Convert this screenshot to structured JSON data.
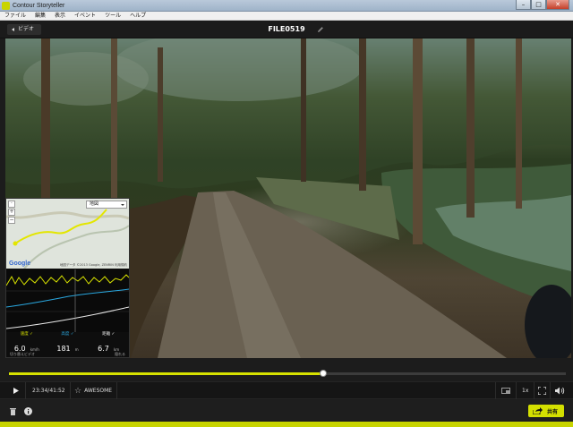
{
  "window": {
    "title": "Contour Storyteller",
    "min_icon": "minimize-icon",
    "max_icon": "maximize-icon",
    "close_icon": "close-icon"
  },
  "menu": {
    "items": [
      "ファイル",
      "編集",
      "表示",
      "イベント",
      "ツール",
      "ヘルプ"
    ]
  },
  "header": {
    "back_label": "ビデオ",
    "file_title": "FILE0519",
    "edit_icon": "pencil-icon"
  },
  "overlay": {
    "map_type": "地図",
    "map_credit": "地図データ ©2013 Google, ZENRIN  利用規約",
    "google_logo": "Google",
    "stats": [
      {
        "label": "速度 ✓",
        "value": "6.0",
        "unit": "km/h",
        "color": "#d6e100"
      },
      {
        "label": "高度 ✓",
        "value": "181",
        "unit": "m",
        "color": "#2aa8e0"
      },
      {
        "label": "距離 ✓",
        "value": "6.7",
        "unit": "km",
        "color": "#e8e8e8"
      }
    ],
    "footer_left": "切り替えビデオ",
    "footer_right": "隠れる"
  },
  "playback": {
    "progress": 0.565,
    "time": "23:34/41:52",
    "tag_label": "AWESOME",
    "speed_label": "1x"
  },
  "actions": {
    "share_label": "共有"
  },
  "colors": {
    "accent": "#d6e100",
    "speed_line": "#d6e100",
    "altitude_line": "#2aa8e0",
    "distance_line": "#ffffff"
  }
}
